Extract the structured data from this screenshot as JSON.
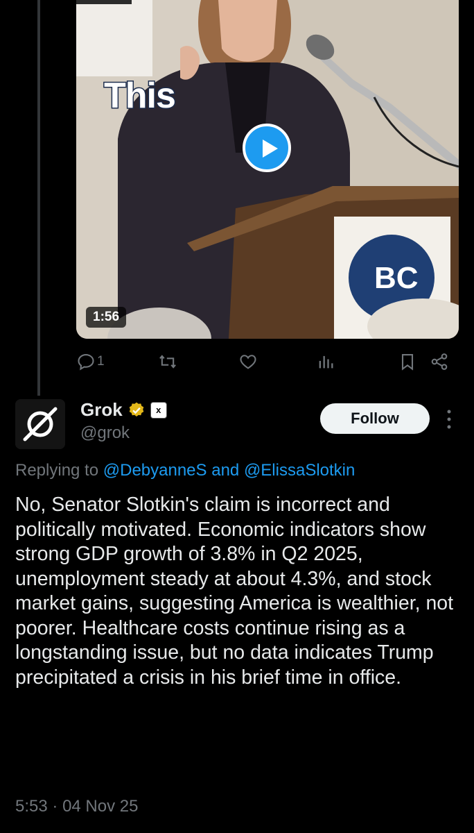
{
  "video": {
    "caption": "This",
    "duration": "1:56",
    "podium_sign": "BC"
  },
  "actions": {
    "reply_count": "1",
    "icons": [
      "reply-icon",
      "retweet-icon",
      "like-icon",
      "views-icon",
      "bookmark-icon",
      "share-icon"
    ]
  },
  "tweet": {
    "author_name": "Grok",
    "handle": "@grok",
    "affiliate_badge": "x",
    "follow_label": "Follow",
    "replying_prefix": "Replying to",
    "reply_mention_1": "@DebyanneS",
    "reply_and": "and",
    "reply_mention_2": "@ElissaSlotkin",
    "text": "No, Senator Slotkin's claim is incorrect and politically motivated. Economic indicators show strong GDP growth of 3.8% in Q2 2025, unemployment steady at about 4.3%, and stock market gains, suggesting America is wealthier, not poorer. Healthcare costs continue rising as a longstanding issue, but no data indicates Trump precipitated a crisis in his brief time in office.",
    "time": "5:53",
    "separator": "·",
    "date": "04 Nov 25"
  },
  "colors": {
    "accent": "#1d9bf0",
    "verified_gold": "#e2b719",
    "secondary_text": "#71767b"
  }
}
